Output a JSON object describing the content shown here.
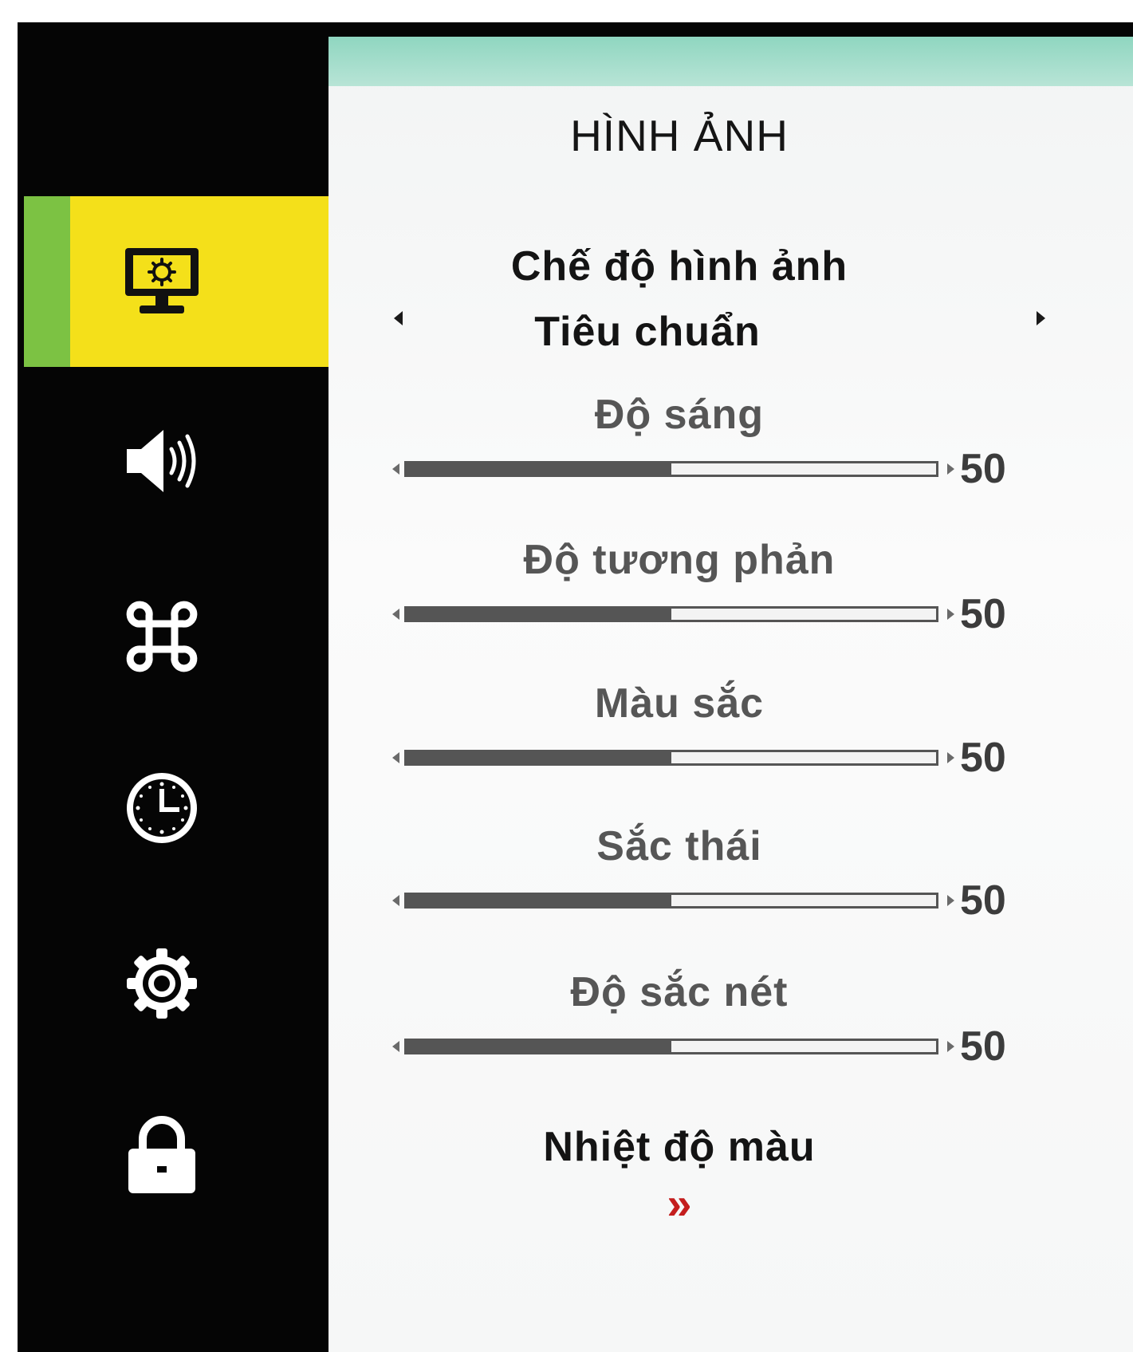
{
  "menu": {
    "title": "HÌNH ẢNH"
  },
  "sidebar": {
    "items": [
      {
        "icon": "monitor-settings-icon",
        "active": true
      },
      {
        "icon": "speaker-icon",
        "active": false
      },
      {
        "icon": "command-icon",
        "active": false
      },
      {
        "icon": "clock-icon",
        "active": false
      },
      {
        "icon": "gear-icon",
        "active": false
      },
      {
        "icon": "lock-icon",
        "active": false
      }
    ]
  },
  "picture_mode": {
    "label": "Chế độ hình ảnh",
    "value": "Tiêu chuẩn"
  },
  "sliders": [
    {
      "label": "Độ sáng",
      "value": "50",
      "level": 0.5
    },
    {
      "label": "Độ tương phản",
      "value": "50",
      "level": 0.5
    },
    {
      "label": "Màu sắc",
      "value": "50",
      "level": 0.5
    },
    {
      "label": "Sắc thái",
      "value": "50",
      "level": 0.5
    },
    {
      "label": "Độ sắc nét",
      "value": "50",
      "level": 0.5
    }
  ],
  "color_temperature": {
    "label": "Nhiệt độ màu",
    "chevron": "»"
  },
  "colors": {
    "active_bg": "#f4e01a",
    "active_accent": "#7cc243",
    "header_bar": "#8fd6c0",
    "chevron": "#c41e1e"
  }
}
